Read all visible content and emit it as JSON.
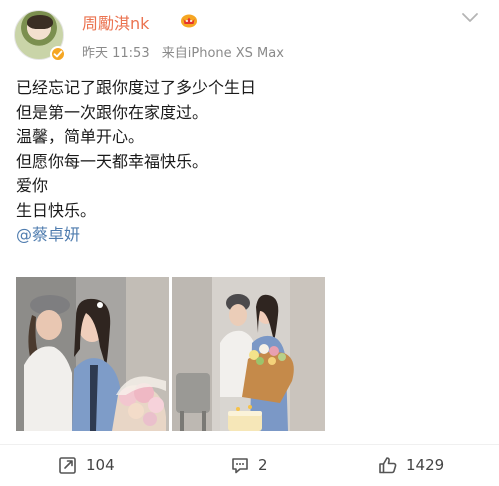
{
  "post": {
    "username": "周勵淇nk",
    "timestamp": "昨天 11:53",
    "source": "来自iPhone XS Max",
    "lines": [
      "已经忘记了跟你度过了多少个生日",
      "但是第一次跟你在家度过。",
      "温馨，简单开心。",
      "但愿你每一天都幸福快乐。",
      "爱你",
      "生日快乐。"
    ],
    "mention": "@蔡卓妍"
  },
  "actions": {
    "repost_count": "104",
    "comment_count": "2",
    "like_count": "1429"
  },
  "icons": {
    "verified": "verified-badge-icon",
    "vip": "vip-crown-icon",
    "more": "chevron-down-icon",
    "repost": "repost-icon",
    "comment": "comment-icon",
    "like": "thumbs-up-icon"
  },
  "colors": {
    "username": "#eb7350",
    "mention": "#507daf",
    "meta": "#8a8a8a",
    "verified": "#f5a623"
  }
}
